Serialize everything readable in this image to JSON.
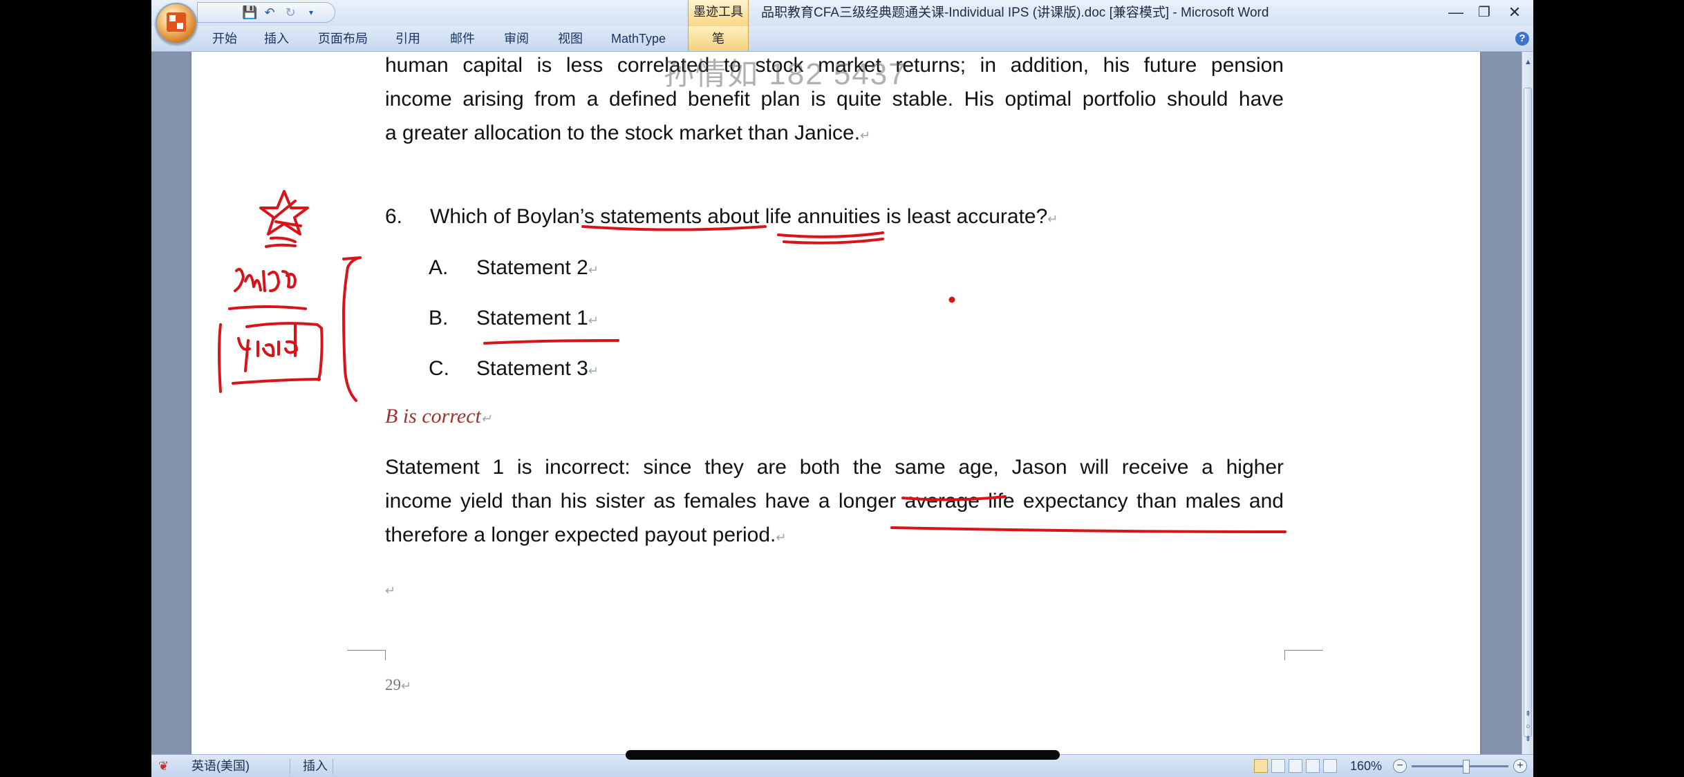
{
  "window": {
    "title": "品职教育CFA三级经典题通关课-Individual IPS (讲课版).doc [兼容模式] - Microsoft Word",
    "ink_tools_label": "墨迹工具",
    "controls": {
      "minimize": "—",
      "restore": "❐",
      "close": "✕"
    }
  },
  "ribbon": {
    "tabs": [
      "开始",
      "插入",
      "页面布局",
      "引用",
      "邮件",
      "审阅",
      "视图",
      "MathType"
    ],
    "pen_tab": "笔",
    "help": "?"
  },
  "document": {
    "watermark": "孙情如 182    5437",
    "para_top": [
      "human capital is less correlated to stock market returns; in addition, his future pension",
      "income arising from a defined benefit plan is quite stable. His optimal portfolio should have",
      "a greater allocation to the stock market than Janice."
    ],
    "question": {
      "number": "6.",
      "text_before": "Which of Boylan’s statements about ",
      "underline1": "life annuities",
      "text_mid": " is ",
      "underline2": "least accurate",
      "text_after": "?"
    },
    "options": [
      {
        "letter": "A.",
        "text": "Statement 2"
      },
      {
        "letter": "B.",
        "text": "Statement 1"
      },
      {
        "letter": "C.",
        "text": "Statement 3"
      }
    ],
    "answer": "B is correct",
    "explanation": [
      "Statement 1 is incorrect: since they are both the same age, Jason will receive a higher",
      "income yield than his sister as females have a longer average life expectancy than males and",
      "therefore a longer expected payout period."
    ],
    "paragraph_mark": "↵",
    "page_number": "29",
    "ink_words": [
      "终身",
      "yield"
    ]
  },
  "status_bar": {
    "language": "英语(美国)",
    "mode": "插入",
    "zoom": "160%",
    "zoom_minus": "−",
    "zoom_plus": "+"
  },
  "colors": {
    "ink": "#d8141b",
    "answer": "#a0312b"
  }
}
